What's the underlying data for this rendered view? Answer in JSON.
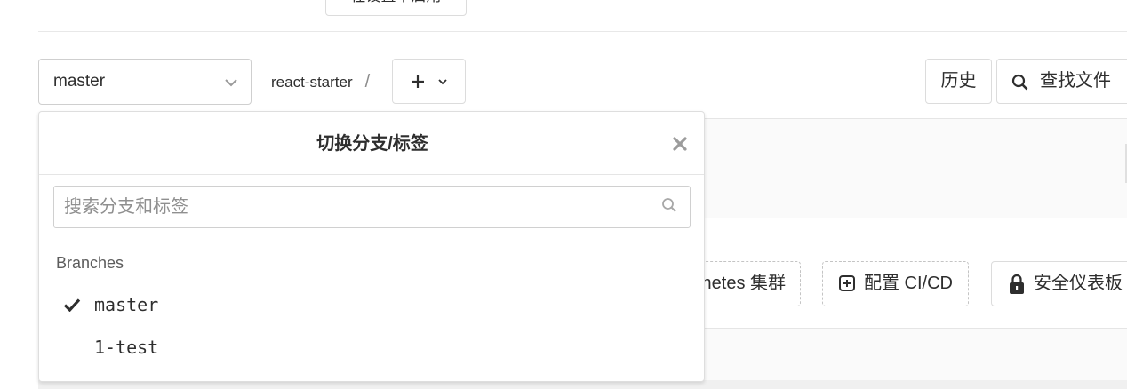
{
  "toolbar": {
    "top_button_label": "在设置中启用",
    "branch_selected": "master",
    "project_name": "react-starter",
    "path_separator": "/",
    "history_label": "历史",
    "find_file_label": "查找文件"
  },
  "actions": {
    "kubernetes_label": "netes 集群",
    "cicd_label": "配置 CI/CD",
    "security_label": "安全仪表板"
  },
  "dropdown": {
    "title": "切换分支/标签",
    "search_placeholder": "搜索分支和标签",
    "section_label": "Branches",
    "items": [
      {
        "label": "master",
        "selected": true
      },
      {
        "label": "1-test",
        "selected": false
      }
    ]
  },
  "colors": {
    "text": "#2e2e2e",
    "border": "#dcdcdc",
    "muted": "#8f8f8f",
    "panel_bg": "#fafafa"
  },
  "icons": [
    "chevron-down-icon",
    "plus-icon",
    "search-icon",
    "plus-square-icon",
    "lock-icon",
    "close-icon",
    "check-icon"
  ]
}
